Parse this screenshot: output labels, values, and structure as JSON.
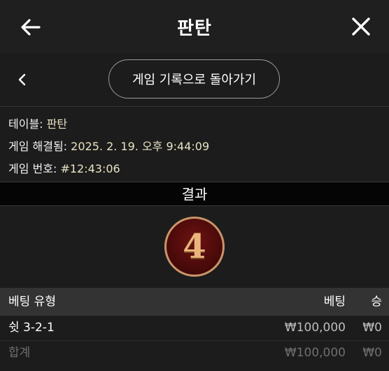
{
  "header": {
    "title": "판탄"
  },
  "nav": {
    "history_button": "게임 기록으로 돌아가기"
  },
  "info": {
    "table_label": "테이블:",
    "table_value": "판탄",
    "resolved_label": "게임 해결됨:",
    "resolved_value": "2025. 2. 19. 오후 9:44:09",
    "game_no_label": "게임 번호:",
    "game_no_value": "#12:43:06"
  },
  "result": {
    "label": "결과",
    "number": "4"
  },
  "table": {
    "headers": {
      "type": "베팅 유형",
      "bet": "베팅",
      "win": "승"
    },
    "rows": [
      {
        "type": "쉿 3-2-1",
        "bet": "₩100,000",
        "win": "₩0"
      }
    ],
    "total": {
      "type": "합계",
      "bet": "₩100,000",
      "win": "₩0"
    }
  },
  "colors": {
    "background": "#1c1c1c",
    "header_row": "#333333",
    "medal": "#5a0d0d",
    "medal_text": "#e9b57c"
  }
}
